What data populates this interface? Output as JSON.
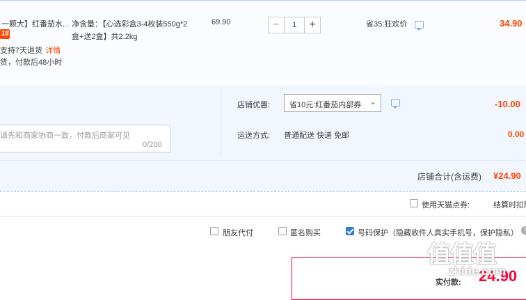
{
  "item": {
    "title": "一颗大】红番茄水...",
    "badge": "18",
    "return_text": "支持7天退货",
    "return_detail": "详情",
    "ship_text": "货，付款后48小时",
    "spec": "净含量：【心选彩盒3-4枚装550g*2盒+送2盒】共2.2kg",
    "unit_price": "69.90",
    "quantity": "1",
    "minus": "−",
    "plus": "+",
    "promo": "省35:狂欢价",
    "total": "34.90"
  },
  "shop": {
    "message_placeholder": "请先和商家协商一致，付款后商家可见",
    "message_count": "0/200",
    "coupon_label": "店铺优惠:",
    "coupon_value": "省10元:红番茄内部券",
    "coupon_amount": "-10.00",
    "shipping_label": "运送方式:",
    "shipping_value": "普通配送 快递 免邮",
    "shipping_amount": "0.00",
    "subtotal_label": "店铺合计(含运费)",
    "subtotal_value": "¥24.90"
  },
  "points": {
    "label": "使用天猫点券:",
    "settle_text": "结算时扣除"
  },
  "options": {
    "friend_pay": "朋友代付",
    "anonymous": "匿名购买",
    "privacy": "号码保护（隐藏收件人真实手机号，保护隐私）",
    "privacy_checked": true
  },
  "payment": {
    "label": "实付款:",
    "amount": "24.90"
  },
  "watermark": {
    "logo": "值值值",
    "url": "zhide.com"
  },
  "colors": {
    "accent": "#ff4400",
    "pay_red": "#ff0036",
    "border_blue": "#b2d1ff",
    "check_blue": "#2d7de0"
  }
}
